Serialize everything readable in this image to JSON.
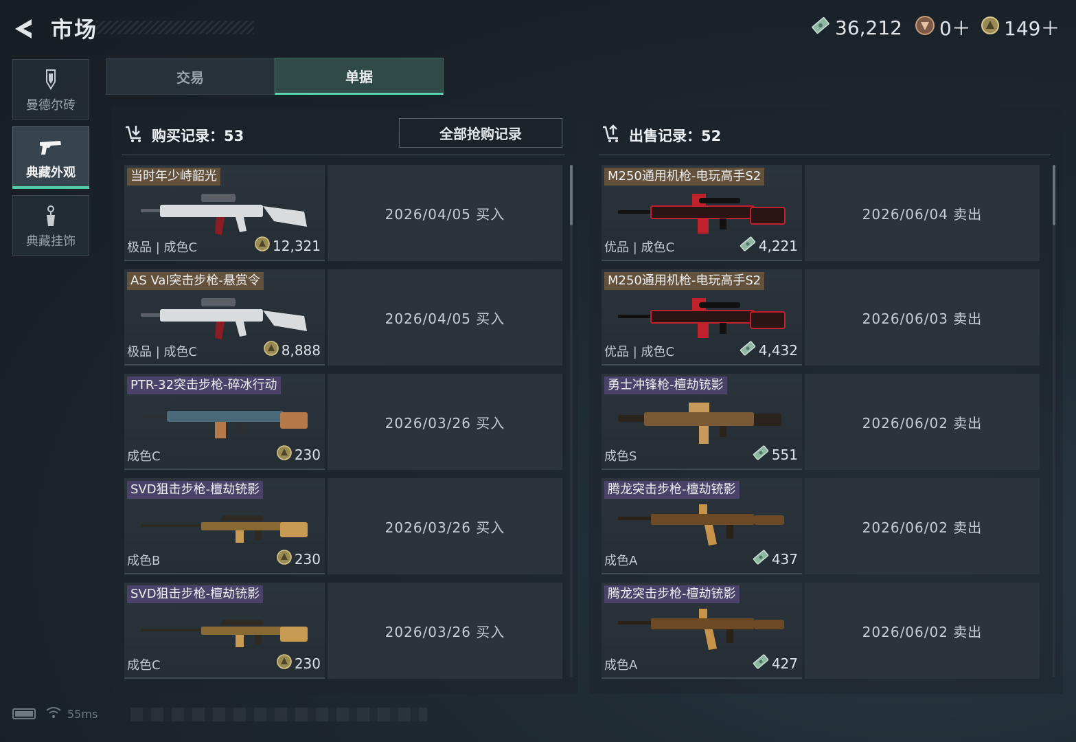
{
  "header": {
    "title": "市场",
    "currencies": {
      "cash": "36,212",
      "token": "0＋",
      "coin": "149＋"
    }
  },
  "sidebar": {
    "items": [
      {
        "label": "曼德尔砖",
        "icon": "brick-icon",
        "active": false
      },
      {
        "label": "典藏外观",
        "icon": "pistol-icon",
        "active": true
      },
      {
        "label": "典藏挂饰",
        "icon": "charm-icon",
        "active": false
      }
    ]
  },
  "tabs": [
    {
      "label": "交易",
      "active": false
    },
    {
      "label": "单据",
      "active": true
    }
  ],
  "purchase": {
    "title": "购买记录：53",
    "all_button": "全部抢购记录",
    "rows": [
      {
        "name": "当时年少峙韶光",
        "tag": "gold",
        "quality": "极品 | 成色C",
        "currency": "coin",
        "price": "12,321",
        "date": "2026/04/05 买入",
        "gun": "white"
      },
      {
        "name": "AS Val突击步枪-悬赏令",
        "tag": "gold",
        "quality": "极品 | 成色C",
        "currency": "coin",
        "price": "8,888",
        "date": "2026/04/05 买入",
        "gun": "white"
      },
      {
        "name": "PTR-32突击步枪-碎冰行动",
        "tag": "purple",
        "quality": "成色C",
        "currency": "coin",
        "price": "230",
        "date": "2026/03/26 买入",
        "gun": "blue"
      },
      {
        "name": "SVD狙击步枪-檀劫铳影",
        "tag": "purple",
        "quality": "成色B",
        "currency": "coin",
        "price": "230",
        "date": "2026/03/26 买入",
        "gun": "sniper"
      },
      {
        "name": "SVD狙击步枪-檀劫铳影",
        "tag": "purple",
        "quality": "成色C",
        "currency": "coin",
        "price": "230",
        "date": "2026/03/26 买入",
        "gun": "sniper"
      }
    ]
  },
  "sale": {
    "title": "出售记录：52",
    "rows": [
      {
        "name": "M250通用机枪-电玩高手S2",
        "tag": "gold",
        "quality": "优品 | 成色C",
        "currency": "cash",
        "price": "4,221",
        "date": "2026/06/04 卖出",
        "gun": "red"
      },
      {
        "name": "M250通用机枪-电玩高手S2",
        "tag": "gold",
        "quality": "优品 | 成色C",
        "currency": "cash",
        "price": "4,432",
        "date": "2026/06/03 卖出",
        "gun": "red"
      },
      {
        "name": "勇士冲锋枪-檀劫铳影",
        "tag": "purple",
        "quality": "成色S",
        "currency": "cash",
        "price": "551",
        "date": "2026/06/02 卖出",
        "gun": "smg"
      },
      {
        "name": "腾龙突击步枪-檀劫铳影",
        "tag": "purple",
        "quality": "成色A",
        "currency": "cash",
        "price": "437",
        "date": "2026/06/02 卖出",
        "gun": "ak"
      },
      {
        "name": "腾龙突击步枪-檀劫铳影",
        "tag": "purple",
        "quality": "成色A",
        "currency": "cash",
        "price": "427",
        "date": "2026/06/02 卖出",
        "gun": "ak"
      }
    ]
  },
  "status": {
    "ping": "55ms"
  }
}
